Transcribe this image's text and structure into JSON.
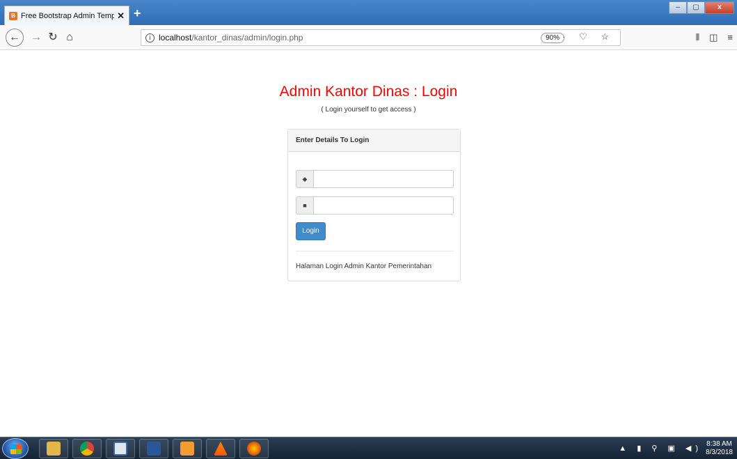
{
  "browser": {
    "tab_title": "Free Bootstrap Admin Templat",
    "tab_close": "✕",
    "new_tab": "+",
    "url_host": "localhost",
    "url_path": "/kantor_dinas/admin/login.php",
    "zoom": "90%",
    "url_actions": "··· ♡ ☆",
    "window_controls": {
      "minimize": "‒",
      "maximize": "▢",
      "close": "x"
    }
  },
  "page": {
    "title": "Admin Kantor Dinas : Login",
    "subtitle": "( Login yourself to get access )"
  },
  "panel": {
    "heading": "Enter Details To Login",
    "username_value": "",
    "password_value": "",
    "login_label": "Login",
    "footer_text": "Halaman Login Admin Kantor Pemerintahan"
  },
  "taskbar": {
    "apps": [
      "windows-explorer",
      "chrome",
      "notepad",
      "word",
      "sublime",
      "vlc",
      "firefox"
    ],
    "clock_time": "8:38 AM",
    "clock_date": "8/3/2018"
  },
  "colors": {
    "title_red": "#ff0000",
    "button_blue": "#428bca"
  }
}
